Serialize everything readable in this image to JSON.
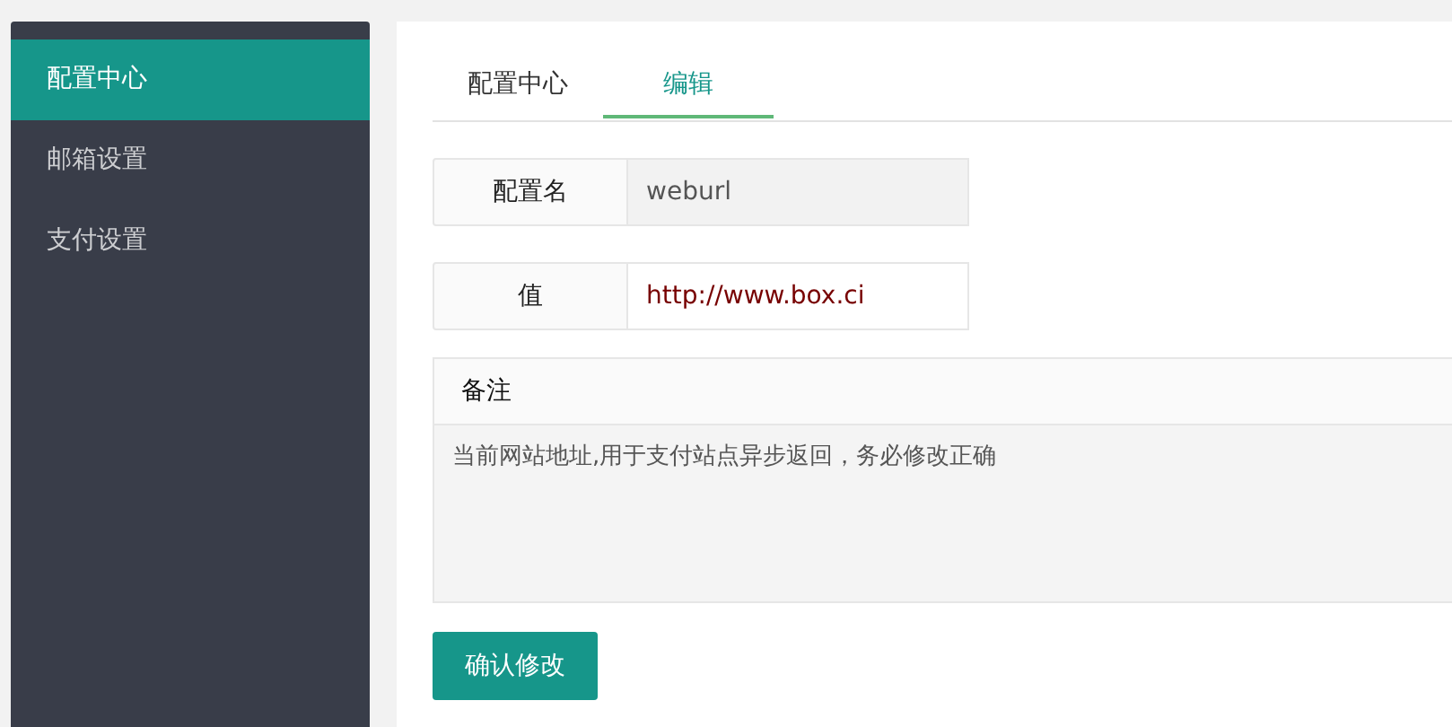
{
  "sidebar": {
    "items": [
      {
        "label": "配置中心",
        "selected": true
      },
      {
        "label": "邮箱设置",
        "selected": false
      },
      {
        "label": "支付设置",
        "selected": false
      }
    ]
  },
  "tabs": [
    {
      "label": "配置中心",
      "selected": false
    },
    {
      "label": "编辑",
      "selected": true
    }
  ],
  "fields": [
    {
      "label": "配置名",
      "value": "weburl",
      "readonly": true
    },
    {
      "label": "值",
      "value": "http://www.box.ci",
      "readonly": false
    }
  ],
  "note": {
    "label": "备注",
    "value": "当前网站地址,用于支付站点异步返回，务必修改正确"
  },
  "submit_button": "确认修改"
}
